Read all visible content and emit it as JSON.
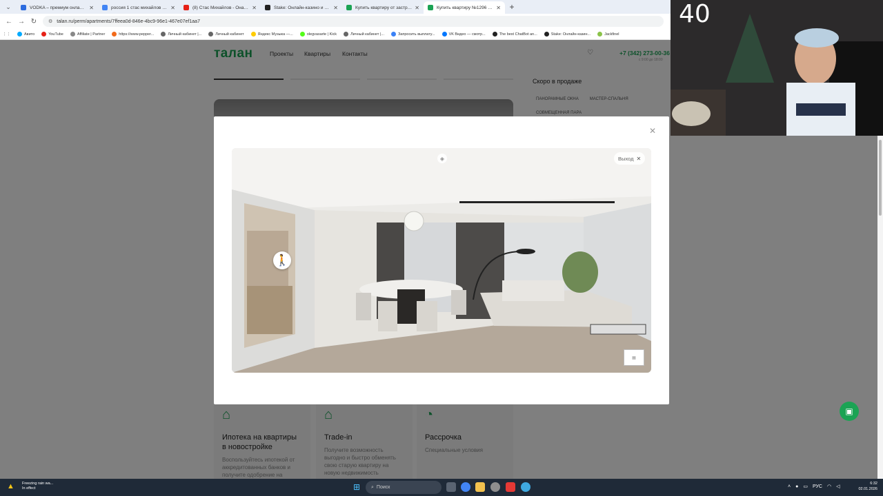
{
  "browser": {
    "tabs": [
      {
        "title": "VODKA – премиум онлайн-каз",
        "icon_color": "#2d6cdf"
      },
      {
        "title": "россия 1 стас михайлов – Пои",
        "icon_color": "#4285f4"
      },
      {
        "title": "(8) Стас Михайлов - Она (Гол",
        "icon_color": "#e62117"
      },
      {
        "title": "Stake: Онлайн-казино и ставк",
        "icon_color": "#222222"
      },
      {
        "title": "Купить квартиру от застройщ",
        "icon_color": "#1ba354"
      },
      {
        "title": "Купить квартиру №1296 в жи",
        "icon_color": "#1ba354"
      }
    ],
    "url": "talan.ru/perm/apartments/7ffeea0d-846e-4bc9-96e1-467e07ef1aa7",
    "bookmarks": [
      {
        "label": "Авито",
        "color": "#00aaff"
      },
      {
        "label": "YouTube",
        "color": "#e62117"
      },
      {
        "label": "Affiliate | Partner",
        "color": "#888888"
      },
      {
        "label": "https://www.pepper...",
        "color": "#f26a1b"
      },
      {
        "label": "Личный кабинет |...",
        "color": "#666666"
      },
      {
        "label": "Личный кабинет",
        "color": "#666666"
      },
      {
        "label": "Яндекс Музыка —...",
        "color": "#ffcc00"
      },
      {
        "label": "olegvasarte | Kick",
        "color": "#53fc18"
      },
      {
        "label": "Личный кабинет |...",
        "color": "#666666"
      },
      {
        "label": "Запросить выплату...",
        "color": "#3b82f6"
      },
      {
        "label": "VK Видео — смотр...",
        "color": "#0077ff"
      },
      {
        "label": "The best ChatBot an...",
        "color": "#222222"
      },
      {
        "label": "Stake: Онлайн-казин...",
        "color": "#222222"
      },
      {
        "label": "Jackfinel",
        "color": "#8bc34a"
      }
    ]
  },
  "site": {
    "logo": "талан",
    "nav": [
      "Проекты",
      "Квартиры",
      "Контакты"
    ],
    "phone": "+7 (342) 273-00-36",
    "phone_sub": "с 9:00 до 18:00",
    "soon_title": "Скоро в продаже",
    "chips": [
      "панорамные окна",
      "мастер-спальня",
      "совмещенная пара"
    ],
    "features": [
      {
        "title": "Ипотека на квартиры в новостройке",
        "desc": "Воспользуйтесь ипотекой от аккредитованных банков и получите одобрение на приобретение квартиры",
        "icon": "house-percent-icon"
      },
      {
        "title": "Trade-in",
        "desc": "Получите возможность выгодно и быстро обменять свою старую квартиру на новую недвижимость",
        "icon": "house-exchange-icon"
      },
      {
        "title": "Рассрочка",
        "desc": "Специальные условия",
        "icon": "installment-icon"
      }
    ]
  },
  "modal": {
    "exit_label": "Выход"
  },
  "stream": {
    "viewer_count": "40"
  },
  "taskbar": {
    "weather_line1": "Freezing rain wa...",
    "weather_line2": "In effect",
    "search_placeholder": "Поиск",
    "lang": "РУС",
    "time": "6:32",
    "date": "02.01.2026"
  }
}
